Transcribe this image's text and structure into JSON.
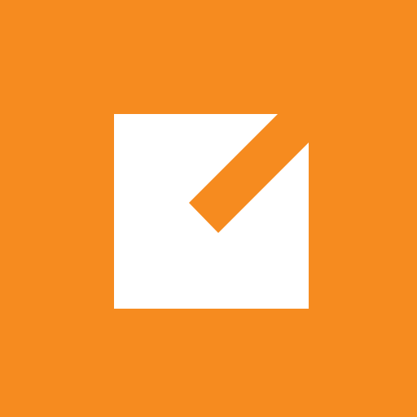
{
  "app_icon": {
    "icon_name": "edit-note-icon",
    "background_color": "#F68B1F",
    "foreground_color": "#FFFFFF"
  }
}
